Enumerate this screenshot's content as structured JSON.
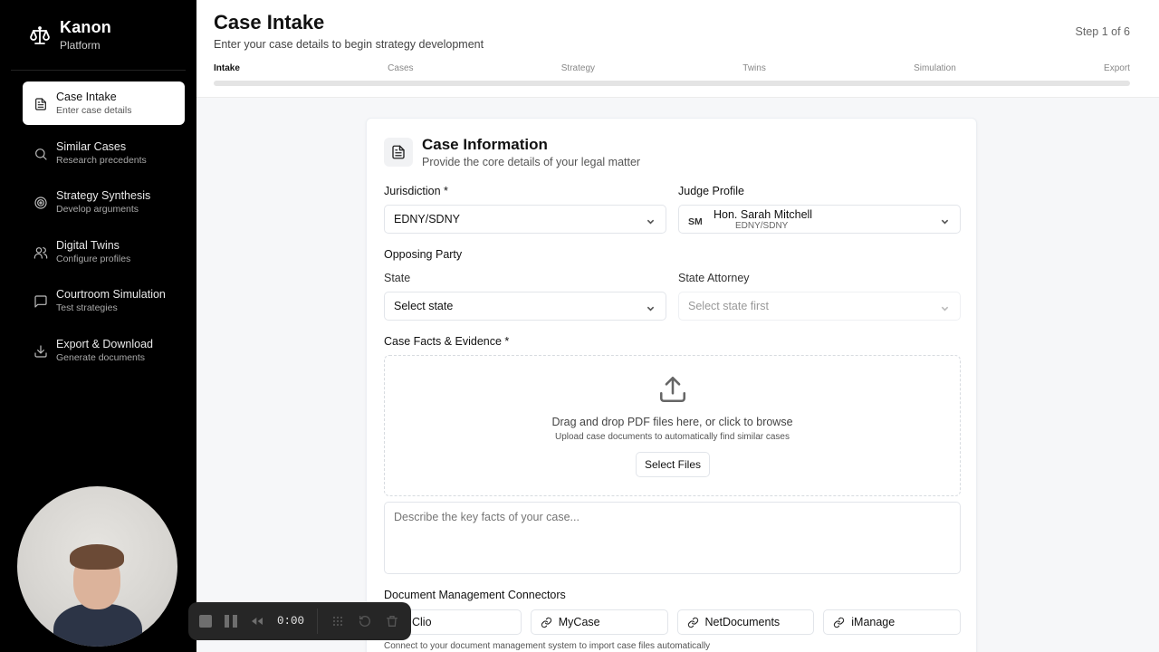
{
  "brand": {
    "name": "Kanon",
    "sub": "Platform"
  },
  "sidebar": {
    "items": [
      {
        "title": "Case Intake",
        "subtitle": "Enter case details",
        "icon": "document-icon",
        "active": true
      },
      {
        "title": "Similar Cases",
        "subtitle": "Research precedents",
        "icon": "search-icon"
      },
      {
        "title": "Strategy Synthesis",
        "subtitle": "Develop arguments",
        "icon": "target-icon"
      },
      {
        "title": "Digital Twins",
        "subtitle": "Configure profiles",
        "icon": "users-icon"
      },
      {
        "title": "Courtroom Simulation",
        "subtitle": "Test strategies",
        "icon": "chat-icon"
      },
      {
        "title": "Export & Download",
        "subtitle": "Generate documents",
        "icon": "download-icon"
      }
    ]
  },
  "header": {
    "title": "Case Intake",
    "subtitle": "Enter your case details to begin strategy development",
    "step_count": "Step 1 of 6",
    "steps": [
      "Intake",
      "Cases",
      "Strategy",
      "Twins",
      "Simulation",
      "Export"
    ],
    "progress": 0
  },
  "card": {
    "title": "Case Information",
    "subtitle": "Provide the core details of your legal matter",
    "jurisdiction_label": "Jurisdiction *",
    "jurisdiction_value": "EDNY/SDNY",
    "judge_label": "Judge Profile",
    "judge_initials": "SM",
    "judge_name": "Hon. Sarah Mitchell",
    "judge_court": "EDNY/SDNY",
    "opposing_label": "Opposing Party",
    "state_label": "State",
    "state_value": "Select state",
    "attorney_label": "State Attorney",
    "attorney_value": "Select state first",
    "facts_label": "Case Facts & Evidence *",
    "dropzone_main": "Drag and drop PDF files here, or click to browse",
    "dropzone_sub": "Upload case documents to automatically find similar cases",
    "select_files": "Select Files",
    "facts_placeholder": "Describe the key facts of your case...",
    "connectors_label": "Document Management Connectors",
    "connectors": [
      "Clio",
      "MyCase",
      "NetDocuments",
      "iManage"
    ],
    "connectors_note": "Connect to your document management system to import case files automatically"
  },
  "recorder": {
    "time": "0:00"
  }
}
